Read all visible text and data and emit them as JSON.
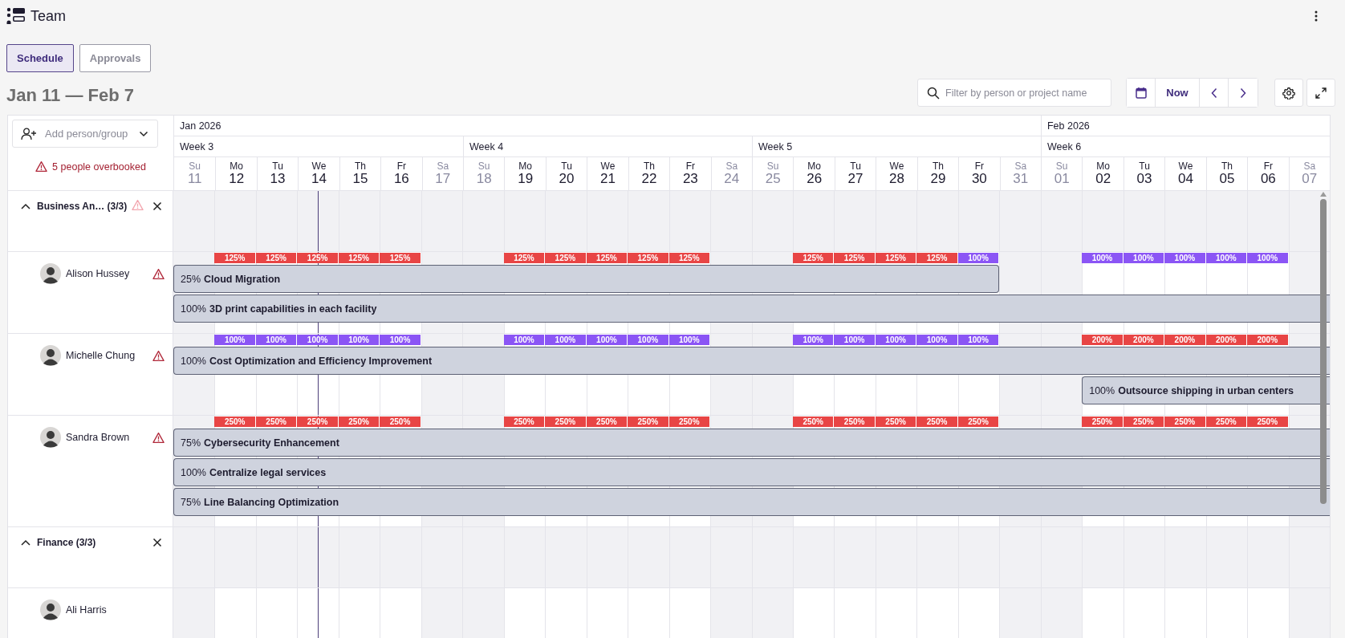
{
  "header": {
    "title": "Team"
  },
  "tabs": [
    {
      "label": "Schedule",
      "selected": true
    },
    {
      "label": "Approvals",
      "selected": false
    }
  ],
  "range_title": "Jan 11 — Feb 7",
  "search": {
    "placeholder": "Filter by person or project name"
  },
  "toolbar": {
    "now_label": "Now"
  },
  "add_person": {
    "placeholder": "Add person/group"
  },
  "overbooked": "5 people overbooked",
  "timeline": {
    "months": [
      {
        "label": "Jan 2026",
        "weeks": [
          {
            "label": "Week 3",
            "days": [
              {
                "weekday": "Su",
                "date": "11",
                "weekend": true,
                "today": false
              },
              {
                "weekday": "Mo",
                "date": "12",
                "weekend": false,
                "today": false
              },
              {
                "weekday": "Tu",
                "date": "13",
                "weekend": false,
                "today": false
              },
              {
                "weekday": "We",
                "date": "14",
                "weekend": false,
                "today": true
              },
              {
                "weekday": "Th",
                "date": "15",
                "weekend": false,
                "today": false
              },
              {
                "weekday": "Fr",
                "date": "16",
                "weekend": false,
                "today": false
              },
              {
                "weekday": "Sa",
                "date": "17",
                "weekend": true,
                "today": false
              }
            ]
          },
          {
            "label": "Week 4",
            "days": [
              {
                "weekday": "Su",
                "date": "18",
                "weekend": true,
                "today": false
              },
              {
                "weekday": "Mo",
                "date": "19",
                "weekend": false,
                "today": false
              },
              {
                "weekday": "Tu",
                "date": "20",
                "weekend": false,
                "today": false
              },
              {
                "weekday": "We",
                "date": "21",
                "weekend": false,
                "today": false
              },
              {
                "weekday": "Th",
                "date": "22",
                "weekend": false,
                "today": false
              },
              {
                "weekday": "Fr",
                "date": "23",
                "weekend": false,
                "today": false
              },
              {
                "weekday": "Sa",
                "date": "24",
                "weekend": true,
                "today": false
              }
            ]
          },
          {
            "label": "Week 5",
            "days": [
              {
                "weekday": "Su",
                "date": "25",
                "weekend": true,
                "today": false
              },
              {
                "weekday": "Mo",
                "date": "26",
                "weekend": false,
                "today": false
              },
              {
                "weekday": "Tu",
                "date": "27",
                "weekend": false,
                "today": false
              },
              {
                "weekday": "We",
                "date": "28",
                "weekend": false,
                "today": false
              },
              {
                "weekday": "Th",
                "date": "29",
                "weekend": false,
                "today": false
              },
              {
                "weekday": "Fr",
                "date": "30",
                "weekend": false,
                "today": false
              },
              {
                "weekday": "Sa",
                "date": "31",
                "weekend": true,
                "today": false
              }
            ]
          }
        ]
      },
      {
        "label": "Feb 2026",
        "weeks": [
          {
            "label": "Week 6",
            "days": [
              {
                "weekday": "Su",
                "date": "01",
                "weekend": true,
                "today": false
              },
              {
                "weekday": "Mo",
                "date": "02",
                "weekend": false,
                "today": false
              },
              {
                "weekday": "Tu",
                "date": "03",
                "weekend": false,
                "today": false
              },
              {
                "weekday": "We",
                "date": "04",
                "weekend": false,
                "today": false
              },
              {
                "weekday": "Th",
                "date": "05",
                "weekend": false,
                "today": false
              },
              {
                "weekday": "Fr",
                "date": "06",
                "weekend": false,
                "today": false
              },
              {
                "weekday": "Sa",
                "date": "07",
                "weekend": true,
                "today": false
              }
            ]
          }
        ]
      }
    ]
  },
  "groups": [
    {
      "name": "Business An… (3/3)",
      "expanded": true,
      "warning": true,
      "people": [
        {
          "name": "Alison Hussey",
          "warning": true,
          "usage": [
            {
              "label": "125%",
              "color": "#e84545"
            },
            {
              "label": "125%",
              "color": "#e84545"
            },
            {
              "label": "125%",
              "color": "#e84545"
            },
            {
              "label": "125%",
              "color": "#e84545"
            },
            {
              "label": "125%",
              "color": "#e84545"
            },
            {
              "label": "125%",
              "color": "#e84545"
            },
            {
              "label": "125%",
              "color": "#e84545"
            },
            {
              "label": "125%",
              "color": "#e84545"
            },
            {
              "label": "125%",
              "color": "#e84545"
            },
            {
              "label": "125%",
              "color": "#e84545"
            },
            {
              "label": "125%",
              "color": "#e84545"
            },
            {
              "label": "125%",
              "color": "#e84545"
            },
            {
              "label": "125%",
              "color": "#e84545"
            },
            {
              "label": "125%",
              "color": "#e84545"
            },
            {
              "label": "100%",
              "color": "#8b55f5"
            },
            {
              "label": "100%",
              "color": "#8b55f5"
            },
            {
              "label": "100%",
              "color": "#8b55f5"
            },
            {
              "label": "100%",
              "color": "#8b55f5"
            },
            {
              "label": "100%",
              "color": "#8b55f5"
            },
            {
              "label": "100%",
              "color": "#8b55f5"
            }
          ],
          "bookings": [
            {
              "percent": "25%",
              "project": "Cloud Migration",
              "days": [
                true,
                true,
                true,
                true,
                true,
                true,
                true,
                true,
                true,
                true,
                true,
                true,
                true,
                true,
                true,
                true,
                true,
                true,
                true,
                true,
                false,
                false,
                false,
                false,
                false,
                false,
                false,
                false
              ]
            },
            {
              "percent": "100%",
              "project": "3D print capabilities in each facility",
              "days": [
                true,
                true,
                true,
                true,
                true,
                true,
                true,
                true,
                true,
                true,
                true,
                true,
                true,
                true,
                true,
                true,
                true,
                true,
                true,
                true,
                true,
                true,
                true,
                true,
                true,
                true,
                true,
                true
              ]
            }
          ]
        },
        {
          "name": "Michelle Chung",
          "warning": true,
          "usage": [
            {
              "label": "100%",
              "color": "#8b55f5"
            },
            {
              "label": "100%",
              "color": "#8b55f5"
            },
            {
              "label": "100%",
              "color": "#8b55f5"
            },
            {
              "label": "100%",
              "color": "#8b55f5"
            },
            {
              "label": "100%",
              "color": "#8b55f5"
            },
            {
              "label": "100%",
              "color": "#8b55f5"
            },
            {
              "label": "100%",
              "color": "#8b55f5"
            },
            {
              "label": "100%",
              "color": "#8b55f5"
            },
            {
              "label": "100%",
              "color": "#8b55f5"
            },
            {
              "label": "100%",
              "color": "#8b55f5"
            },
            {
              "label": "100%",
              "color": "#8b55f5"
            },
            {
              "label": "100%",
              "color": "#8b55f5"
            },
            {
              "label": "100%",
              "color": "#8b55f5"
            },
            {
              "label": "100%",
              "color": "#8b55f5"
            },
            {
              "label": "100%",
              "color": "#8b55f5"
            },
            {
              "label": "200%",
              "color": "#e84545"
            },
            {
              "label": "200%",
              "color": "#e84545"
            },
            {
              "label": "200%",
              "color": "#e84545"
            },
            {
              "label": "200%",
              "color": "#e84545"
            },
            {
              "label": "200%",
              "color": "#e84545"
            }
          ],
          "bookings": [
            {
              "percent": "100%",
              "project": "Cost Optimization and Efficiency Improvement",
              "days": [
                true,
                true,
                true,
                true,
                true,
                true,
                true,
                true,
                true,
                true,
                true,
                true,
                true,
                true,
                true,
                true,
                true,
                true,
                true,
                true,
                true,
                true,
                true,
                true,
                true,
                true,
                true,
                true
              ]
            },
            {
              "percent": "100%",
              "project": "Outsource shipping in urban centers",
              "days": [
                false,
                false,
                false,
                false,
                false,
                false,
                false,
                false,
                false,
                false,
                false,
                false,
                false,
                false,
                false,
                false,
                false,
                false,
                false,
                false,
                false,
                false,
                true,
                true,
                true,
                true,
                true,
                true
              ]
            }
          ]
        },
        {
          "name": "Sandra Brown",
          "warning": true,
          "usage": [
            {
              "label": "250%",
              "color": "#e84545"
            },
            {
              "label": "250%",
              "color": "#e84545"
            },
            {
              "label": "250%",
              "color": "#e84545"
            },
            {
              "label": "250%",
              "color": "#e84545"
            },
            {
              "label": "250%",
              "color": "#e84545"
            },
            {
              "label": "250%",
              "color": "#e84545"
            },
            {
              "label": "250%",
              "color": "#e84545"
            },
            {
              "label": "250%",
              "color": "#e84545"
            },
            {
              "label": "250%",
              "color": "#e84545"
            },
            {
              "label": "250%",
              "color": "#e84545"
            },
            {
              "label": "250%",
              "color": "#e84545"
            },
            {
              "label": "250%",
              "color": "#e84545"
            },
            {
              "label": "250%",
              "color": "#e84545"
            },
            {
              "label": "250%",
              "color": "#e84545"
            },
            {
              "label": "250%",
              "color": "#e84545"
            },
            {
              "label": "250%",
              "color": "#e84545"
            },
            {
              "label": "250%",
              "color": "#e84545"
            },
            {
              "label": "250%",
              "color": "#e84545"
            },
            {
              "label": "250%",
              "color": "#e84545"
            },
            {
              "label": "250%",
              "color": "#e84545"
            }
          ],
          "bookings": [
            {
              "percent": "75%",
              "project": "Cybersecurity Enhancement",
              "days": [
                true,
                true,
                true,
                true,
                true,
                true,
                true,
                true,
                true,
                true,
                true,
                true,
                true,
                true,
                true,
                true,
                true,
                true,
                true,
                true,
                true,
                true,
                true,
                true,
                true,
                true,
                true,
                true
              ]
            },
            {
              "percent": "100%",
              "project": "Centralize legal services",
              "days": [
                true,
                true,
                true,
                true,
                true,
                true,
                true,
                true,
                true,
                true,
                true,
                true,
                true,
                true,
                true,
                true,
                true,
                true,
                true,
                true,
                true,
                true,
                true,
                true,
                true,
                true,
                true,
                true
              ]
            },
            {
              "percent": "75%",
              "project": "Line Balancing Optimization",
              "days": [
                true,
                true,
                true,
                true,
                true,
                true,
                true,
                true,
                true,
                true,
                true,
                true,
                true,
                true,
                true,
                true,
                true,
                true,
                true,
                true,
                true,
                true,
                true,
                true,
                true,
                true,
                true,
                true
              ]
            }
          ]
        }
      ]
    },
    {
      "name": "Finance (3/3)",
      "expanded": true,
      "warning": false,
      "people": [
        {
          "name": "Ali Harris",
          "warning": false
        }
      ]
    }
  ]
}
